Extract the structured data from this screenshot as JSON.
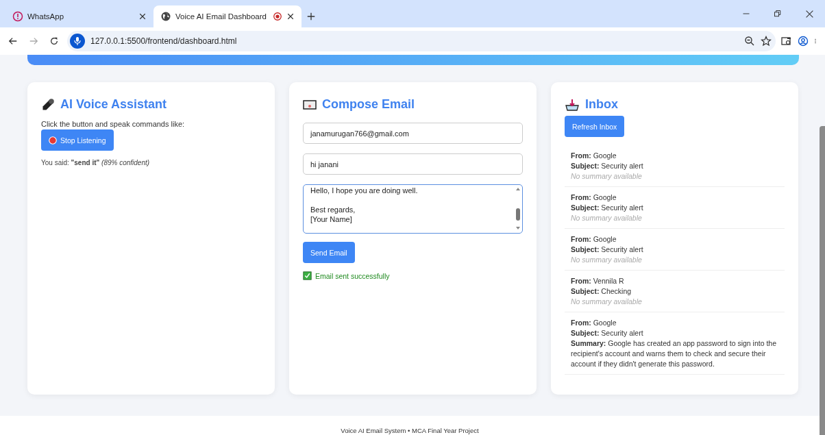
{
  "browser": {
    "tabs": [
      {
        "title": "WhatsApp",
        "kind": "alert",
        "selected": false,
        "recording": false
      },
      {
        "title": "Voice AI Email Dashboard",
        "kind": "globe",
        "selected": true,
        "recording": true
      }
    ],
    "url": "127.0.0.1:5500/frontend/dashboard.html"
  },
  "assistant": {
    "title": "AI Voice Assistant",
    "hint": "Click the button and speak commands like:",
    "button": "Stop Listening",
    "listening": true,
    "heard": "You said: **\"send it\"** *(89% confident)*"
  },
  "compose": {
    "title": "Compose Email",
    "to": "janamurugan766@gmail.com",
    "subject": "hi janani",
    "body": "Hello, I hope you are doing well.\n\nBest regards,\n[Your Name]",
    "button": "Send Email",
    "status": "Email sent successfully"
  },
  "inbox": {
    "title": "Inbox",
    "button": "Refresh Inbox",
    "emails": [
      {
        "from_label": "From:",
        "from": "Google",
        "subject_label": "Subject:",
        "subject": "Security alert",
        "kind": "none",
        "summary": "No summary available"
      },
      {
        "from_label": "From:",
        "from": "Google",
        "subject_label": "Subject:",
        "subject": "Security alert",
        "kind": "none",
        "summary": "No summary available"
      },
      {
        "from_label": "From:",
        "from": "Google",
        "subject_label": "Subject:",
        "subject": "Security alert",
        "kind": "none",
        "summary": "No summary available"
      },
      {
        "from_label": "From:",
        "from": "Vennila R",
        "subject_label": "Subject:",
        "subject": "Checking",
        "kind": "none",
        "summary": "No summary available"
      },
      {
        "from_label": "From:",
        "from": "Google",
        "subject_label": "Subject:",
        "subject": "Security alert",
        "kind": "summary",
        "summary": "**Summary:** Google has created an app password to sign into the recipient's account and warns them to check and secure their account if they didn't generate this password."
      }
    ]
  },
  "footer": "Voice AI Email System • MCA Final Year Project"
}
